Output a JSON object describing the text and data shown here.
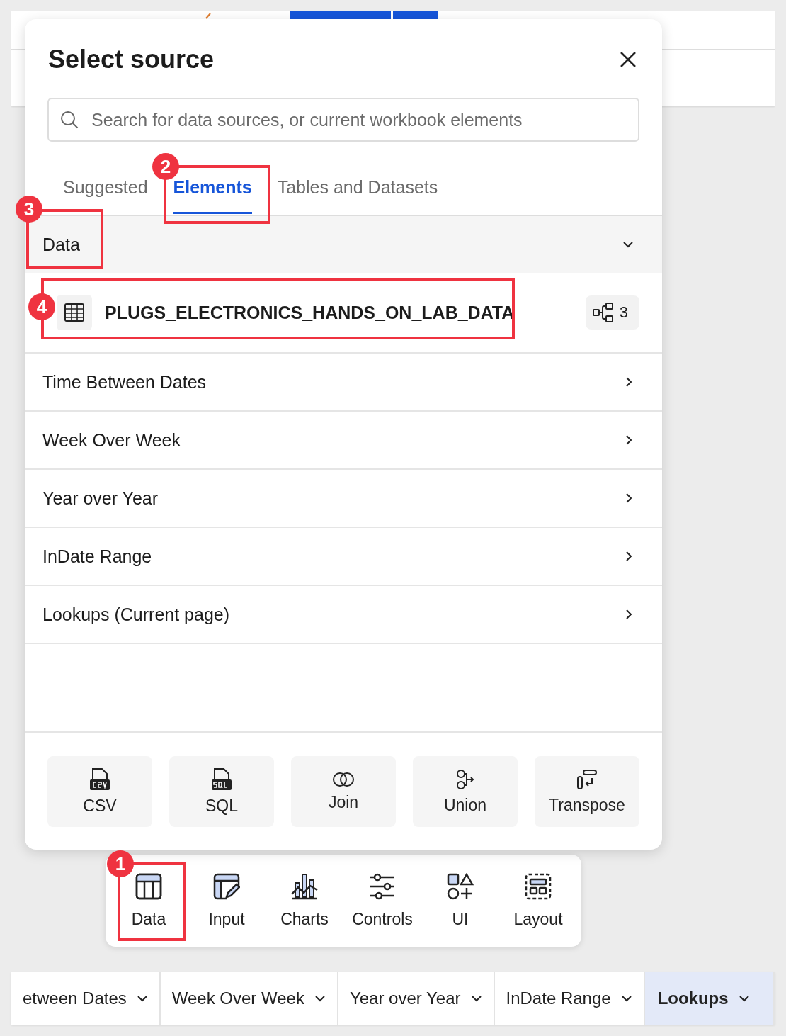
{
  "dialog": {
    "title": "Select source",
    "search": {
      "placeholder": "Search for data sources, or current workbook elements"
    },
    "tabs": [
      {
        "label": "Suggested",
        "selected": false
      },
      {
        "label": "Elements",
        "selected": true
      },
      {
        "label": "Tables and Datasets",
        "selected": false
      }
    ],
    "section": {
      "label": "Data",
      "expanded": true
    },
    "element": {
      "name": "PLUGS_ELECTRONICS_HANDS_ON_LAB_DATA",
      "count": "3"
    },
    "items": [
      {
        "label": "Time Between Dates",
        "expanded": false
      },
      {
        "label": "Week Over Week",
        "expanded": false
      },
      {
        "label": "Year over Year",
        "expanded": false
      },
      {
        "label": "InDate Range",
        "expanded": false
      },
      {
        "label": "Lookups (Current page)",
        "expanded": false
      }
    ],
    "actions": [
      {
        "label": "CSV",
        "kind": "csv"
      },
      {
        "label": "SQL",
        "kind": "sql"
      },
      {
        "label": "Join",
        "kind": "join"
      },
      {
        "label": "Union",
        "kind": "union"
      },
      {
        "label": "Transpose",
        "kind": "transpose"
      }
    ]
  },
  "toolbar": [
    {
      "label": "Data",
      "kind": "data"
    },
    {
      "label": "Input",
      "kind": "input"
    },
    {
      "label": "Charts",
      "kind": "charts"
    },
    {
      "label": "Controls",
      "kind": "controls"
    },
    {
      "label": "UI",
      "kind": "ui"
    },
    {
      "label": "Layout",
      "kind": "layout"
    }
  ],
  "page_tabs": [
    {
      "label": "etween Dates",
      "selected": false
    },
    {
      "label": "Week Over Week",
      "selected": false
    },
    {
      "label": "Year over Year",
      "selected": false
    },
    {
      "label": "InDate Range",
      "selected": false
    },
    {
      "label": "Lookups",
      "selected": true
    }
  ],
  "annotations": [
    {
      "number": "1"
    },
    {
      "number": "2"
    },
    {
      "number": "3"
    },
    {
      "number": "4"
    }
  ]
}
